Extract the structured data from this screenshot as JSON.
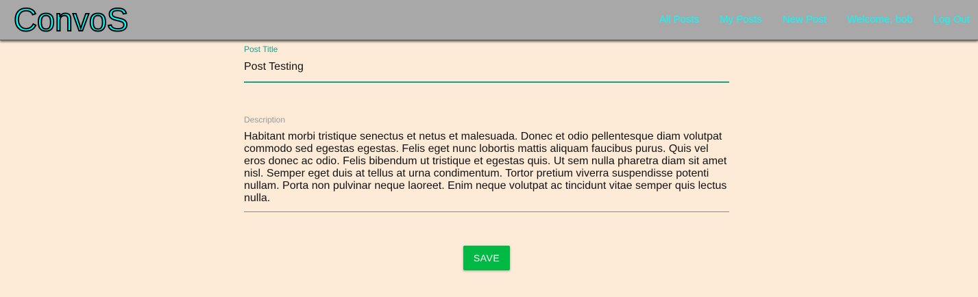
{
  "header": {
    "logo": "ConvoS",
    "nav": [
      {
        "label": "All Posts"
      },
      {
        "label": "My Posts"
      },
      {
        "label": "New Post"
      },
      {
        "label": "Welcome, bob"
      },
      {
        "label": "Log Out"
      }
    ]
  },
  "form": {
    "title_label": "Post Title",
    "title_value": "Post Testing",
    "description_label": "Description",
    "description_value": "Habitant morbi tristique senectus et netus et malesuada. Donec et odio pellentesque diam volutpat commodo sed egestas egestas. Felis eget nunc lobortis mattis aliquam faucibus purus. Quis vel eros donec ac odio. Felis bibendum ut tristique et egestas quis. Ut sem nulla pharetra diam sit amet nisl. Semper eget duis at tellus at urna condimentum. Tortor pretium viverra suspendisse potenti nullam. Porta non pulvinar neque laoreet. Enim neque volutpat ac tincidunt vitae semper quis lectus nulla.",
    "save_label": "SAVE"
  },
  "colors": {
    "background": "#fdebd7",
    "navbar": "#a8a8a8",
    "nav_text": "#00ffff",
    "accent": "#1aa08e",
    "save_button": "#00b844"
  }
}
